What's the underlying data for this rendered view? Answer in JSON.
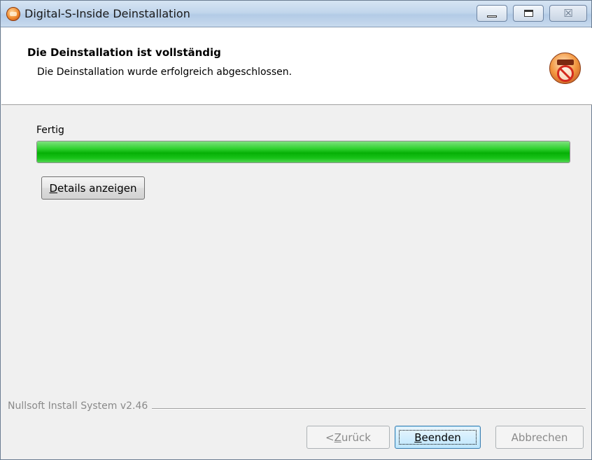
{
  "window": {
    "title": "Digital-S-Inside Deinstallation",
    "icons": {
      "app": "installer-disc-icon",
      "minimize": "minimize-icon",
      "maximize": "maximize-icon",
      "close": "close-icon"
    },
    "close_glyph": "☒"
  },
  "header": {
    "title": "Die Deinstallation ist vollständig",
    "subtitle": "Die Deinstallation wurde erfolgreich abgeschlossen.",
    "icon": "uninstall-disc-icon"
  },
  "main": {
    "status": "Fertig",
    "progress": 1.0,
    "progress_color": "#06b006",
    "details_button": {
      "mnemonic": "D",
      "rest": "etails anzeigen"
    }
  },
  "footer": {
    "branding": "Nullsoft Install System v2.46",
    "back_button": {
      "prefix": "< ",
      "mnemonic": "Z",
      "rest": "urück",
      "enabled": false
    },
    "finish_button": {
      "mnemonic": "B",
      "rest": "eenden",
      "enabled": true
    },
    "cancel_button": {
      "label": "Abbrechen",
      "enabled": false
    }
  }
}
